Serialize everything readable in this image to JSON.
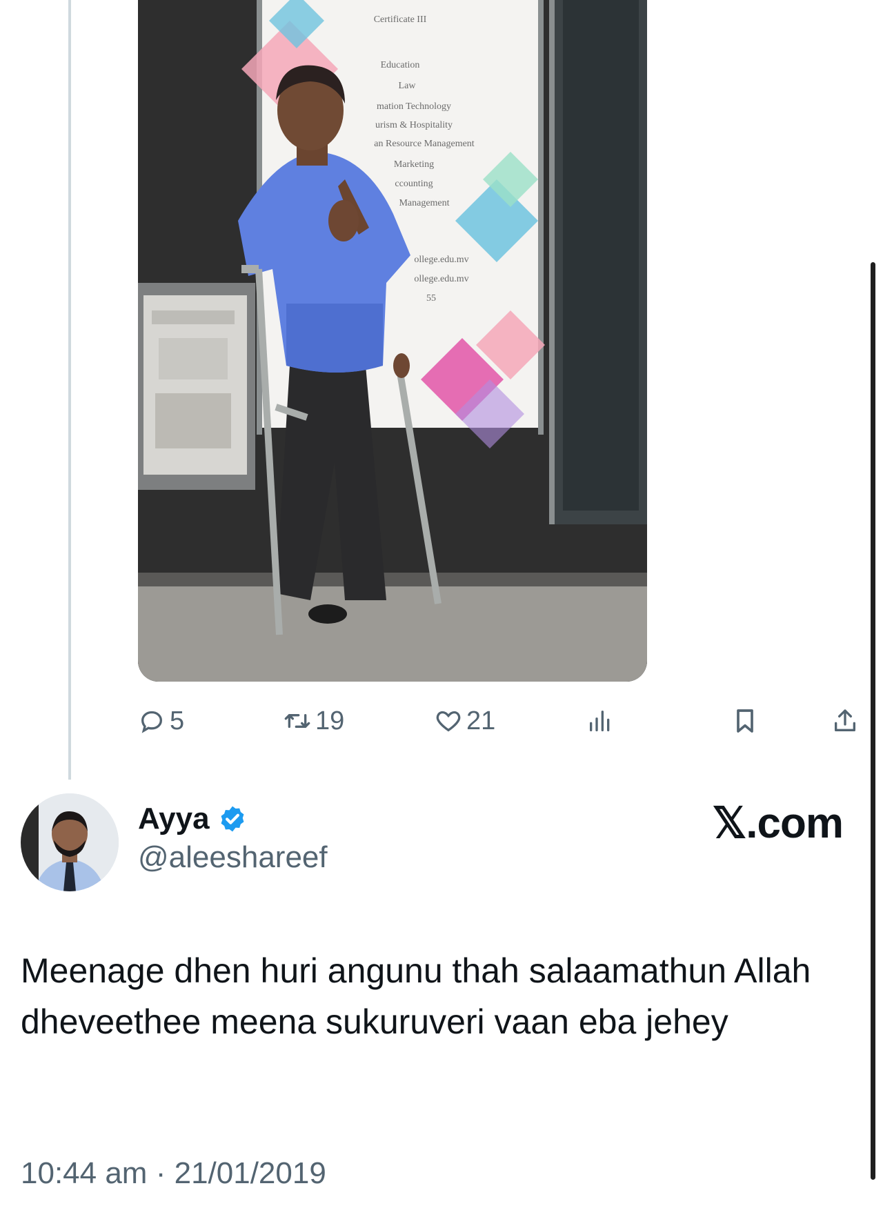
{
  "tweet_media": {
    "poster_lines": [
      "Certificate III",
      "Education",
      "Law",
      "mation Technology",
      "urism & Hospitality",
      "an Resource Management",
      "Marketing",
      "ccounting",
      "Management",
      "ollege.edu.mv",
      "ollege.edu.mv",
      "55"
    ]
  },
  "actions": {
    "reply_count": "5",
    "retweet_count": "19",
    "like_count": "21"
  },
  "reply": {
    "author_name": "Ayya",
    "handle": "@aleeshareef",
    "brand": "𝕏.com",
    "text": "Meenage dhen huri angunu thah salaamathun Allah dheveethee meena sukuruveri vaan eba jehey",
    "time": "10:44 am",
    "date": "21/01/2019",
    "separator": "·"
  },
  "colors": {
    "verified": "#1d9bf0",
    "muted": "#536471",
    "text": "#0f1419"
  }
}
